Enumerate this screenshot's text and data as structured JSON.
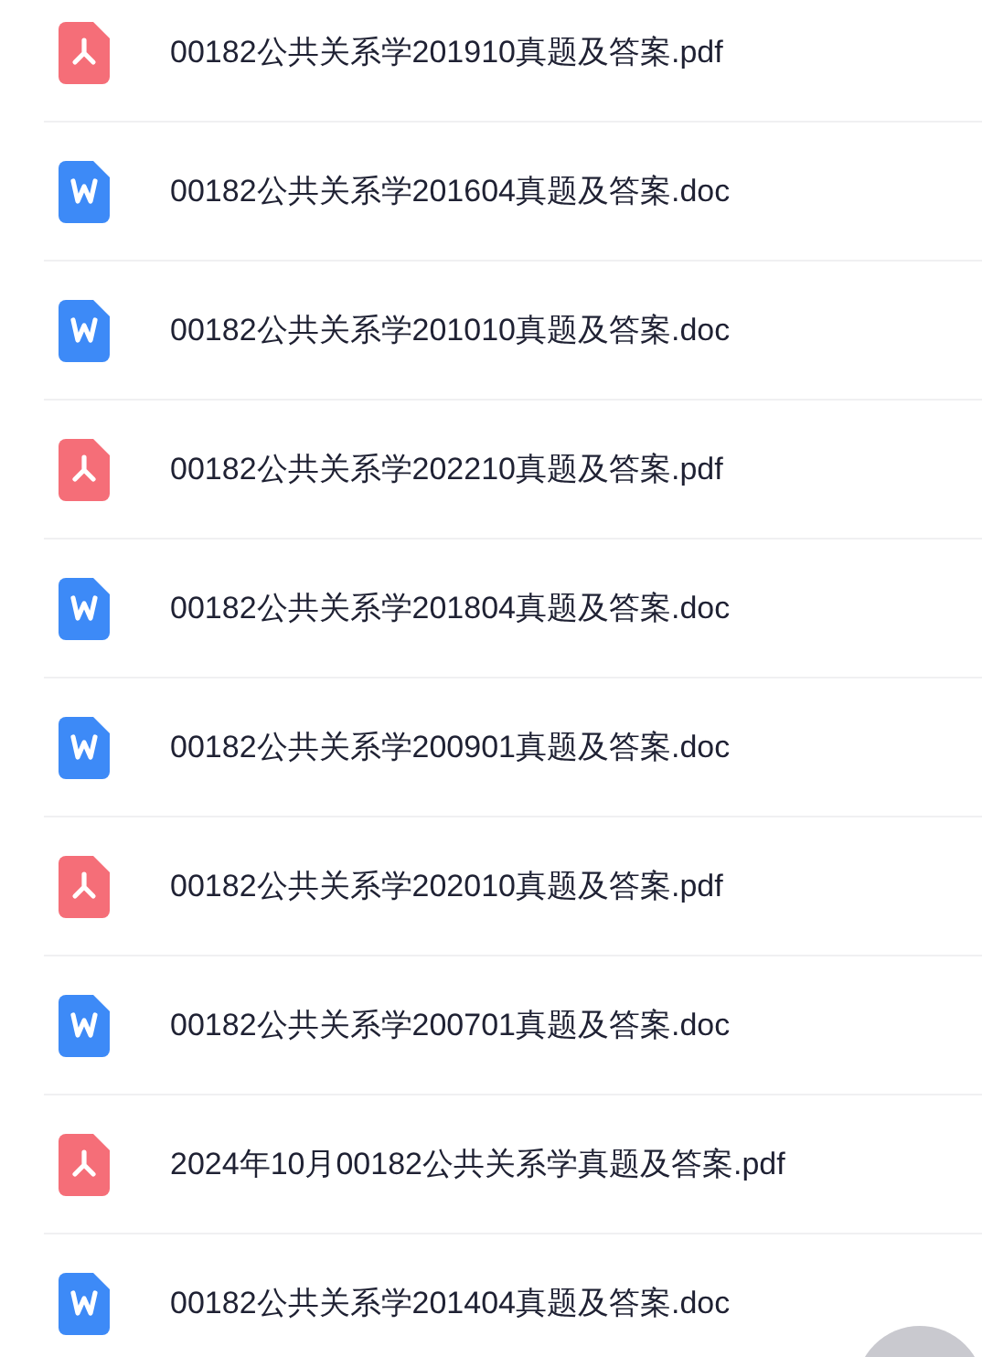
{
  "files": [
    {
      "kind": "pdf",
      "name": "00182公共关系学201910真题及答案.pdf"
    },
    {
      "kind": "doc",
      "name": "00182公共关系学201604真题及答案.doc"
    },
    {
      "kind": "doc",
      "name": "00182公共关系学201010真题及答案.doc"
    },
    {
      "kind": "pdf",
      "name": "00182公共关系学202210真题及答案.pdf"
    },
    {
      "kind": "doc",
      "name": "00182公共关系学201804真题及答案.doc"
    },
    {
      "kind": "doc",
      "name": "00182公共关系学200901真题及答案.doc"
    },
    {
      "kind": "pdf",
      "name": "00182公共关系学202010真题及答案.pdf"
    },
    {
      "kind": "doc",
      "name": "00182公共关系学200701真题及答案.doc"
    },
    {
      "kind": "pdf",
      "name": "2024年10月00182公共关系学真题及答案.pdf"
    },
    {
      "kind": "doc",
      "name": "00182公共关系学201404真题及答案.doc"
    }
  ]
}
